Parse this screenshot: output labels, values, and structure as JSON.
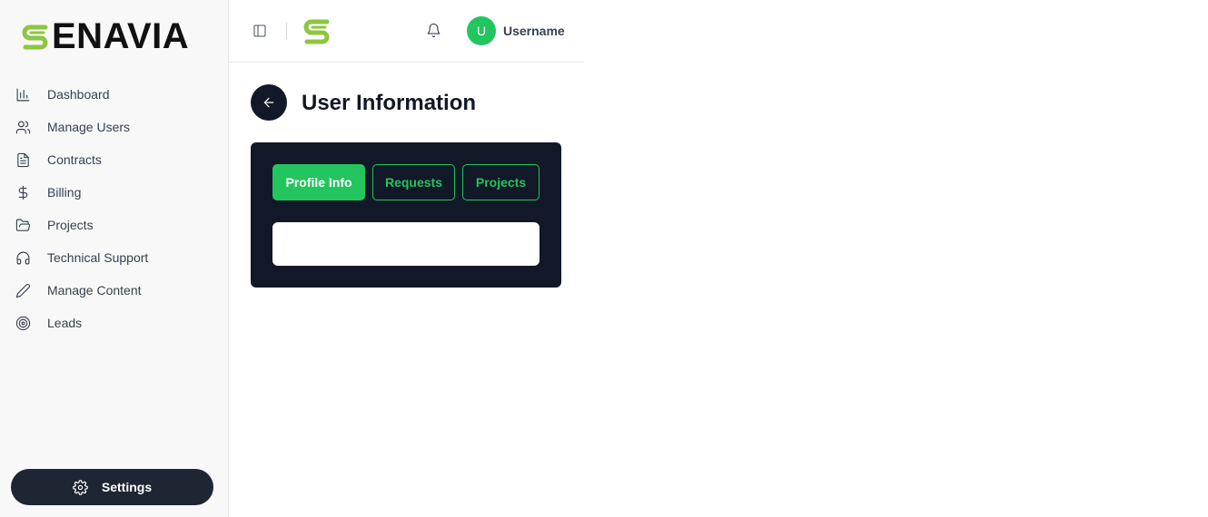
{
  "brand": {
    "name": "ENAVIA",
    "logo_icon": "senavia-s-logo-icon",
    "accent": "#8dc63f"
  },
  "sidebar": {
    "items": [
      {
        "label": "Dashboard",
        "icon": "bar-chart-icon"
      },
      {
        "label": "Manage Users",
        "icon": "users-icon"
      },
      {
        "label": "Contracts",
        "icon": "file-text-icon"
      },
      {
        "label": "Billing",
        "icon": "dollar-icon"
      },
      {
        "label": "Projects",
        "icon": "folder-open-icon"
      },
      {
        "label": "Technical Support",
        "icon": "headphones-icon"
      },
      {
        "label": "Manage Content",
        "icon": "pencil-icon"
      },
      {
        "label": "Leads",
        "icon": "target-icon"
      }
    ],
    "settings_label": "Settings"
  },
  "header": {
    "avatar_initial": "U",
    "username": "Username"
  },
  "main": {
    "title": "User Information",
    "tabs": [
      {
        "label": "Profile Info",
        "active": true
      },
      {
        "label": "Requests",
        "active": false
      },
      {
        "label": "Projects",
        "active": false
      }
    ]
  },
  "colors": {
    "primary_green": "#22c55e",
    "dark_navy": "#111827",
    "settings_bg": "#1e2533",
    "sidebar_bg": "#f8f8f8"
  }
}
